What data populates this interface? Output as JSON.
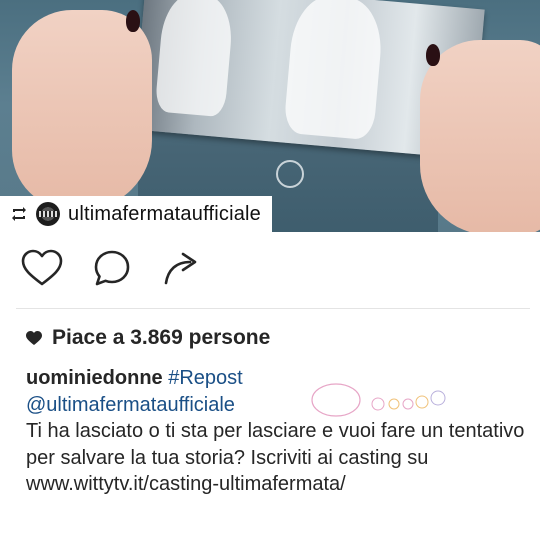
{
  "repost": {
    "username": "ultimafermataufficiale"
  },
  "likes": {
    "text": "Piace a 3.869 persone"
  },
  "caption": {
    "username": "uominiedonne",
    "hashtag": "#Repost",
    "mention": "@ultimafermataufficiale",
    "body": "Ti ha lasciato o ti sta per lasciare e vuoi fare un tentativo per salvare la tua storia? Iscriviti ai casting su www.wittytv.it/casting-ultimafermata/"
  },
  "colors": {
    "link": "#1a4f86",
    "text": "#262626",
    "nail_polish": "#2a1014"
  },
  "icons": [
    "repost-icon",
    "heart-icon",
    "comment-icon",
    "share-icon",
    "heart-filled-icon"
  ]
}
